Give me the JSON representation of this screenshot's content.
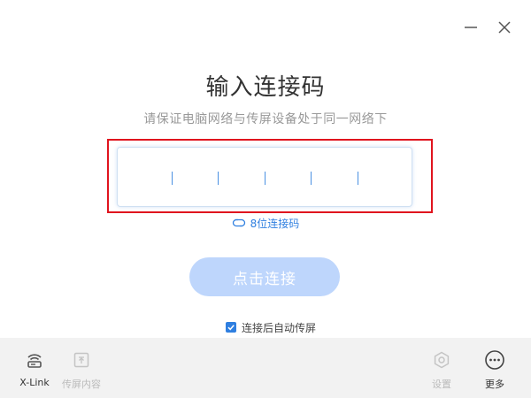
{
  "window": {
    "minimize_icon": "minimize-icon",
    "close_icon": "close-icon"
  },
  "main": {
    "title": "输入连接码",
    "subtitle": "请保证电脑网络与传屏设备处于同一网络下",
    "code_input": {
      "value": "",
      "slots": 6
    },
    "switch_code_label": "8位连接码",
    "connect_button_label": "点击连接",
    "auto_cast": {
      "label": "连接后自动传屏",
      "checked": true
    }
  },
  "bottom_bar": {
    "items": [
      {
        "label": "X-Link",
        "icon": "xlink-icon",
        "enabled": true
      },
      {
        "label": "传屏内容",
        "icon": "cast-content-icon",
        "enabled": false
      },
      {
        "label": "设置",
        "icon": "settings-icon",
        "enabled": false
      },
      {
        "label": "更多",
        "icon": "more-icon",
        "enabled": true
      }
    ]
  },
  "colors": {
    "accent": "#2f7fe0",
    "button_disabled": "#bed6fc",
    "highlight": "#e0141e",
    "bottom_bar_bg": "#f2f2f2"
  }
}
